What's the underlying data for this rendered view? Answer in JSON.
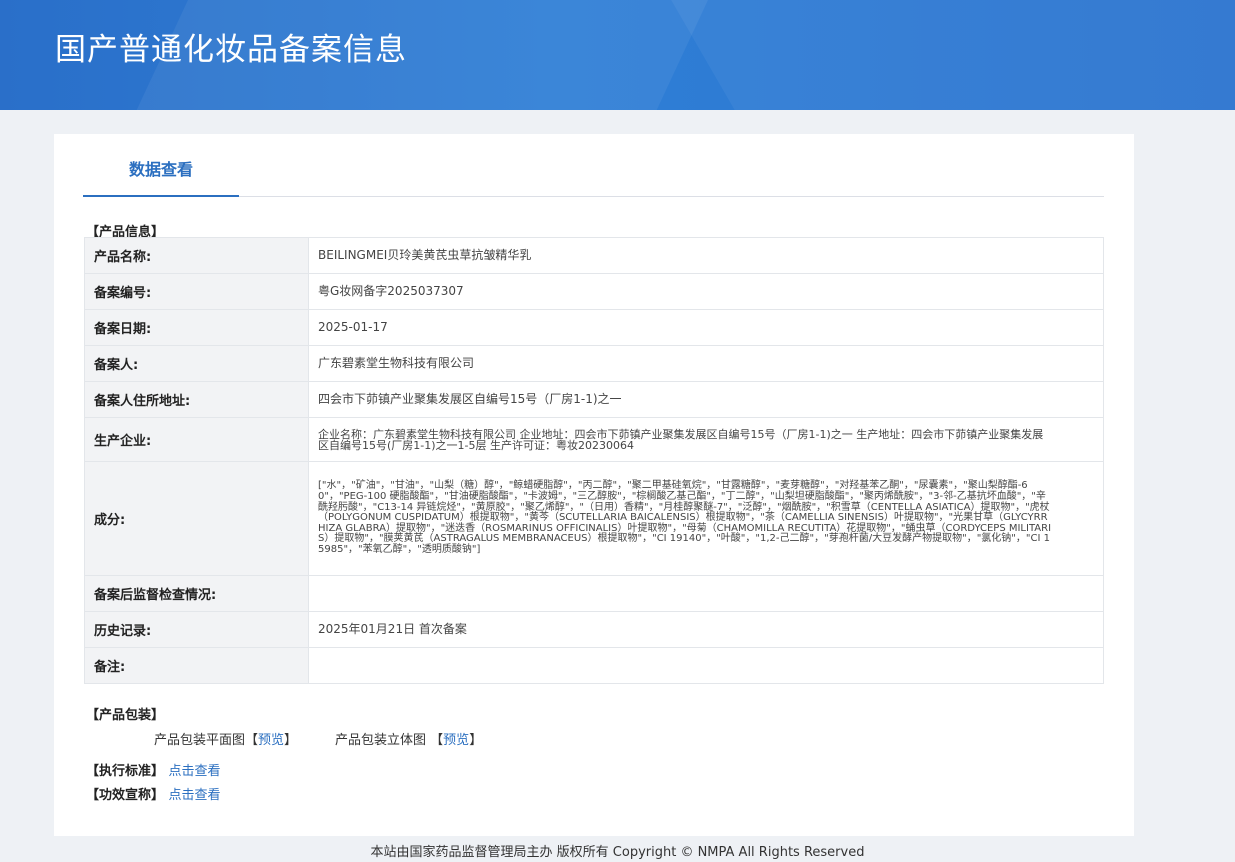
{
  "header": {
    "title": "国产普通化妆品备案信息"
  },
  "tabs": [
    {
      "label": "数据查看"
    }
  ],
  "product_section": {
    "label": "【产品信息】"
  },
  "rows": [
    {
      "key": "产品名称:",
      "value": "BEILINGMEI贝玲美黄芪虫草抗皱精华乳"
    },
    {
      "key": "备案编号:",
      "value": "粤G妆网备字2025037307"
    },
    {
      "key": "备案日期:",
      "value": "2025-01-17"
    },
    {
      "key": "备案人:",
      "value": "广东碧素堂生物科技有限公司"
    },
    {
      "key": "备案人住所地址:",
      "value": "四会市下茆镇产业聚集发展区自编号15号（厂房1-1)之一"
    },
    {
      "key": "生产企业:",
      "value": "企业名称：广东碧素堂生物科技有限公司 企业地址：四会市下茆镇产业聚集发展区自编号15号（厂房1-1)之一 生产地址：四会市下茆镇产业聚集发展区自编号15号(厂房1-1)之一1-5层 生产许可证：粤妆20230064"
    },
    {
      "key": "成分:",
      "value": "[\"水\"，\"矿油\"，\"甘油\"，\"山梨（糖）醇\"，\"鲸蜡硬脂醇\"，\"丙二醇\"，\"聚二甲基硅氧烷\"，\"甘露糖醇\"，\"麦芽糖醇\"，\"对羟基苯乙酮\"，\"尿囊素\"，\"聚山梨醇酯-60\"，\"PEG-100 硬脂酸酯\"，\"甘油硬脂酸酯\"，\"卡波姆\"，\"三乙醇胺\"，\"棕榈酸乙基己酯\"，\"丁二醇\"，\"山梨坦硬脂酸酯\"，\"聚丙烯酰胺\"，\"3-邻-乙基抗坏血酸\"，\"辛酰羟肟酸\"，\"C13-14 异链烷烃\"，\"黄原胶\"，\"聚乙烯醇\"，\"（日用）香精\"，\"月桂醇聚醚-7\"，\"泛醇\"，\"烟酰胺\"，\"积雪草（CENTELLA ASIATICA）提取物\"，\"虎杖（POLYGONUM CUSPIDATUM）根提取物\"，\"黄芩（SCUTELLARIA BAICALENSIS）根提取物\"，\"茶（CAMELLIA SINENSIS）叶提取物\"，\"光果甘草（GLYCYRRHIZA GLABRA）提取物\"，\"迷迭香（ROSMARINUS OFFICINALIS）叶提取物\"，\"母菊（CHAMOMILLA RECUTITA）花提取物\"，\"蛹虫草（CORDYCEPS MILITARIS）提取物\"，\"膜荚黄芪（ASTRAGALUS MEMBRANACEUS）根提取物\"，\"CI 19140\"，\"叶酸\"，\"1,2-己二醇\"，\"芽孢杆菌/大豆发酵产物提取物\"，\"氯化钠\"，\"CI 15985\"，\"苯氧乙醇\"，\"透明质酸钠\"]"
    },
    {
      "key": "备案后监督检查情况:",
      "value": ""
    },
    {
      "key": "历史记录:",
      "value": "2025年01月21日 首次备案"
    },
    {
      "key": "备注:",
      "value": ""
    }
  ],
  "package_section": {
    "label": "【产品包装】",
    "flat_label": "产品包装平面图",
    "flat_link": "预览",
    "solid_label": "产品包装立体图",
    "solid_link": "预览",
    "bracket_open": "【",
    "bracket_close": "】"
  },
  "standard": {
    "label": "【执行标准】",
    "link": "点击查看"
  },
  "efficacy": {
    "label": "【功效宣称】",
    "link": "点击查看"
  },
  "footer": {
    "text": "本站由国家药品监督管理局主办 版权所有 Copyright © NMPA All Rights Reserved"
  }
}
